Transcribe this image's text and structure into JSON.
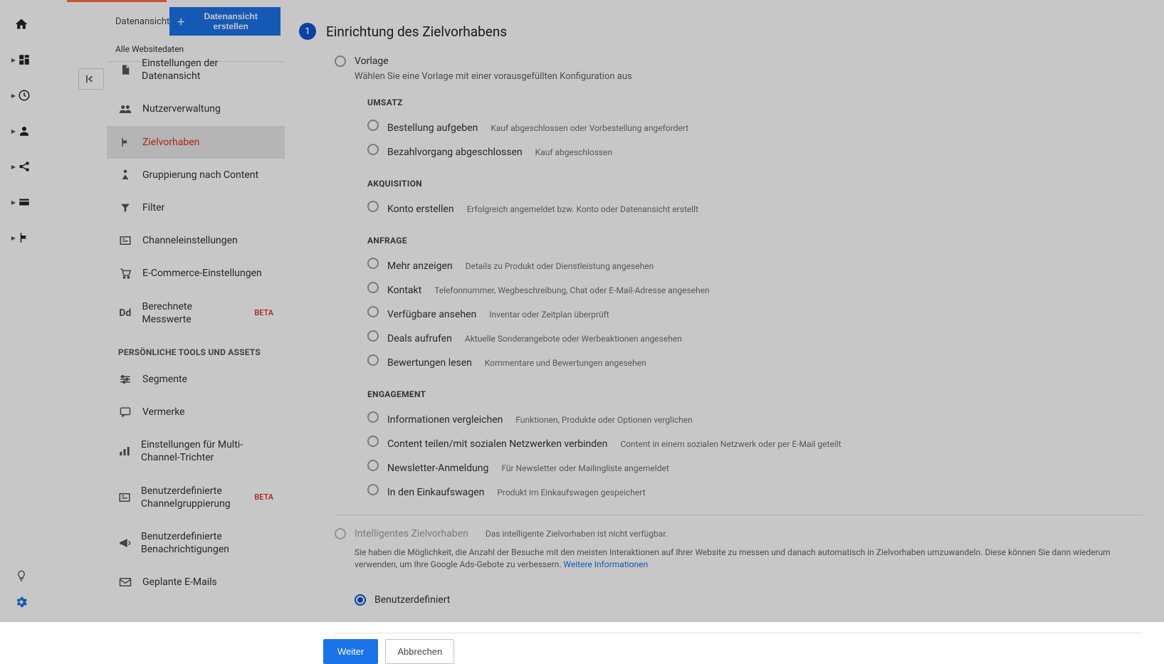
{
  "rail": {
    "items": [
      "home",
      "dashboard",
      "realtime",
      "audience",
      "acquisition",
      "conversions",
      "flag"
    ]
  },
  "sidebar": {
    "title": "Datenansicht",
    "create_button": "Datenansicht erstellen",
    "subtitle": "Alle Websitedaten",
    "items": [
      {
        "label": "Einstellungen der Datenansicht",
        "icon": "doc"
      },
      {
        "label": "Nutzerverwaltung",
        "icon": "users"
      },
      {
        "label": "Zielvorhaben",
        "icon": "flag",
        "active": true
      },
      {
        "label": "Gruppierung nach Content",
        "icon": "group"
      },
      {
        "label": "Filter",
        "icon": "filter"
      },
      {
        "label": "Channeleinstellungen",
        "icon": "channel"
      },
      {
        "label": "E-Commerce-Einstellungen",
        "icon": "cart"
      },
      {
        "label": "Berechnete Messwerte",
        "icon": "dd",
        "beta": "BETA"
      }
    ],
    "section_title": "PERSÖNLICHE TOOLS UND ASSETS",
    "tools": [
      {
        "label": "Segmente",
        "icon": "segments"
      },
      {
        "label": "Vermerke",
        "icon": "note"
      },
      {
        "label": "Einstellungen für Multi-Channel-Trichter",
        "icon": "bars"
      },
      {
        "label": "Benutzerdefinierte Channelgruppierung",
        "icon": "channel",
        "beta": "BETA"
      },
      {
        "label": "Benutzerdefinierte Benachrichtigungen",
        "icon": "megaphone"
      },
      {
        "label": "Geplante E-Mails",
        "icon": "mail"
      }
    ]
  },
  "main": {
    "step_number": "1",
    "step_title": "Einrichtung des Zielvorhabens",
    "vorlage": {
      "label": "Vorlage",
      "desc": "Wählen Sie eine Vorlage mit einer vorausgefüllten Konfiguration aus",
      "sections": [
        {
          "title": "UMSATZ",
          "opts": [
            {
              "label": "Bestellung aufgeben",
              "desc": "Kauf abgeschlossen oder Vorbestellung angefordert"
            },
            {
              "label": "Bezahlvorgang abgeschlossen",
              "desc": "Kauf abgeschlossen"
            }
          ]
        },
        {
          "title": "AKQUISITION",
          "opts": [
            {
              "label": "Konto erstellen",
              "desc": "Erfolgreich angemeldet bzw. Konto oder Datenansicht erstellt"
            }
          ]
        },
        {
          "title": "ANFRAGE",
          "opts": [
            {
              "label": "Mehr anzeigen",
              "desc": "Details zu Produkt oder Dienstleistung angesehen"
            },
            {
              "label": "Kontakt",
              "desc": "Telefonnummer, Wegbeschreibung, Chat oder E-Mail-Adresse angesehen"
            },
            {
              "label": "Verfügbare ansehen",
              "desc": "Inventar oder Zeitplan überprüft"
            },
            {
              "label": "Deals aufrufen",
              "desc": "Aktuelle Sonderangebote oder Werbeaktionen angesehen"
            },
            {
              "label": "Bewertungen lesen",
              "desc": "Kommentare und Bewertungen angesehen"
            }
          ]
        },
        {
          "title": "ENGAGEMENT",
          "opts": [
            {
              "label": "Informationen vergleichen",
              "desc": "Funktionen, Produkte oder Optionen verglichen"
            },
            {
              "label": "Content teilen/mit sozialen Netzwerken verbinden",
              "desc": "Content in einem sozialen Netzwerk oder per E-Mail geteilt"
            },
            {
              "label": "Newsletter-Anmeldung",
              "desc": "Für Newsletter oder Mailingliste angemeldet"
            },
            {
              "label": "In den Einkaufswagen",
              "desc": "Produkt im Einkaufswagen gespeichert"
            }
          ]
        }
      ]
    },
    "smart": {
      "label": "Intelligentes Zielvorhaben",
      "note": "Das intelligente Zielvorhaben ist nicht verfügbar.",
      "desc": "Sie haben die Möglichkeit, die Anzahl der Besuche mit den meisten Interaktionen auf Ihrer Website zu messen und danach automatisch in Zielvorhaben umzuwandeln. Diese können Sie dann wiederum verwenden, um Ihre Google Ads-Gebote zu verbessern.",
      "link": "Weitere Informationen"
    },
    "custom": {
      "label": "Benutzerdefiniert"
    },
    "buttons": {
      "next": "Weiter",
      "cancel": "Abbrechen"
    }
  }
}
